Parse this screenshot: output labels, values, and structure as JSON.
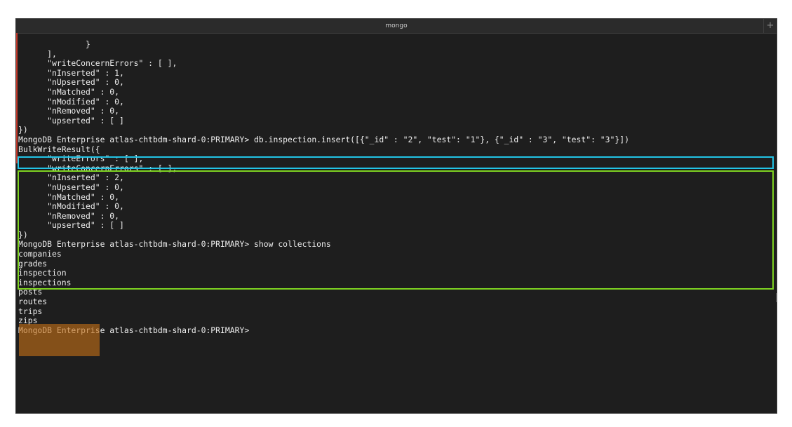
{
  "window": {
    "title": "mongo",
    "new_tab_symbol": "+"
  },
  "terminal": {
    "lines": [
      "              }",
      "      ],",
      "      \"writeConcernErrors\" : [ ],",
      "      \"nInserted\" : 1,",
      "      \"nUpserted\" : 0,",
      "      \"nMatched\" : 0,",
      "      \"nModified\" : 0,",
      "      \"nRemoved\" : 0,",
      "      \"upserted\" : [ ]",
      "})",
      "MongoDB Enterprise atlas-chtbdm-shard-0:PRIMARY> db.inspection.insert([{\"_id\" : \"2\", \"test\": \"1\"}, {\"_id\" : \"3\", \"test\": \"3\"}])",
      "BulkWriteResult({",
      "      \"writeErrors\" : [ ],",
      "      \"writeConcernErrors\" : [ ],",
      "      \"nInserted\" : 2,",
      "      \"nUpserted\" : 0,",
      "      \"nMatched\" : 0,",
      "      \"nModified\" : 0,",
      "      \"nRemoved\" : 0,",
      "      \"upserted\" : [ ]",
      "})",
      "MongoDB Enterprise atlas-chtbdm-shard-0:PRIMARY> show collections",
      "companies",
      "grades",
      "inspection",
      "inspections",
      "posts",
      "routes",
      "trips",
      "zips",
      "MongoDB Enterprise atlas-chtbdm-shard-0:PRIMARY>"
    ]
  },
  "highlights": {
    "command_box_color": "#22c4e6",
    "result_box_color": "#7ed321",
    "collections_marker_color": "#c47016",
    "left_edge_color": "#c0392b"
  }
}
